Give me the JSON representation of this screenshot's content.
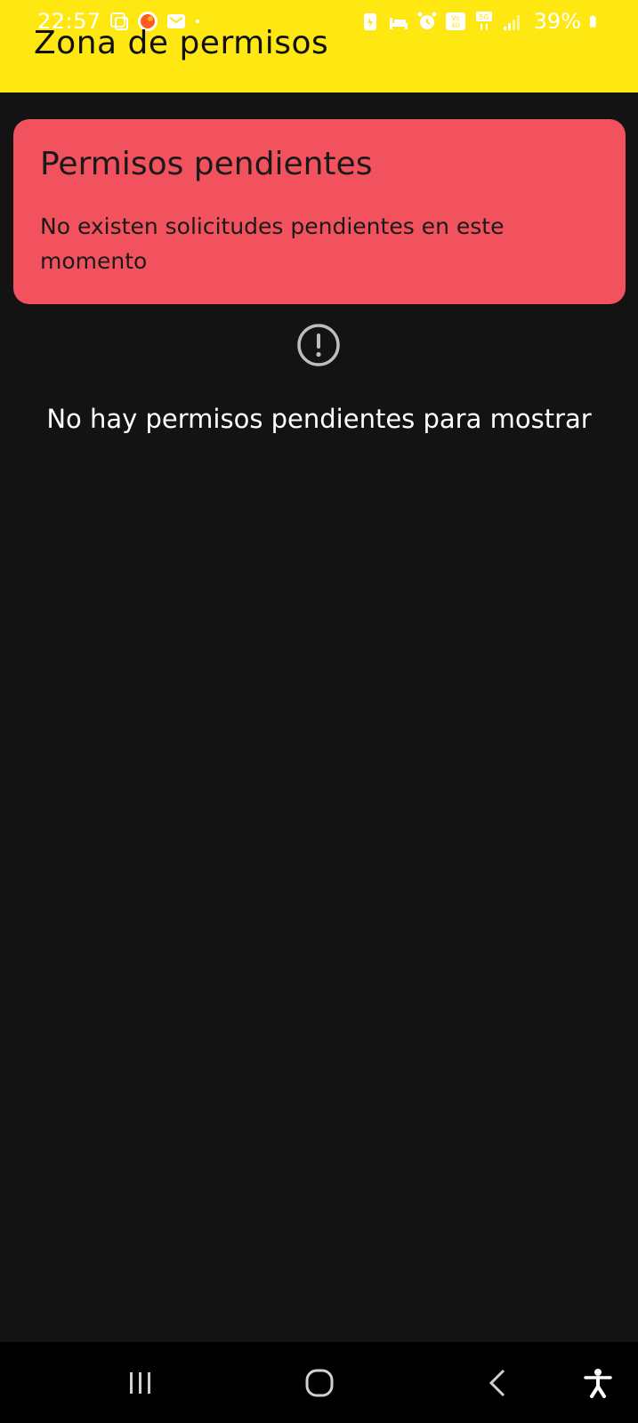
{
  "status_bar": {
    "time": "22:57",
    "battery": "39%",
    "icons_left": [
      "screenshot-icon",
      "notification-app-icon",
      "mail-icon",
      "dot-icon"
    ],
    "icons_right": [
      "battery-saver-icon",
      "sleep-icon",
      "alarm-icon",
      "volte-icon",
      "5g-icon",
      "signal-icon",
      "battery-icon"
    ]
  },
  "app_bar": {
    "title": "Zona de permisos",
    "color": "#FFE812"
  },
  "pending_card": {
    "title": "Permisos pendientes",
    "message": "No existen solicitudes pendientes en este momento",
    "color": "#F2525E"
  },
  "empty_state": {
    "icon": "alert-circle-icon",
    "text": "No hay permisos pendientes para mostrar"
  },
  "nav_bar": {
    "items": [
      "recents-icon",
      "home-icon",
      "back-icon",
      "accessibility-icon"
    ]
  }
}
